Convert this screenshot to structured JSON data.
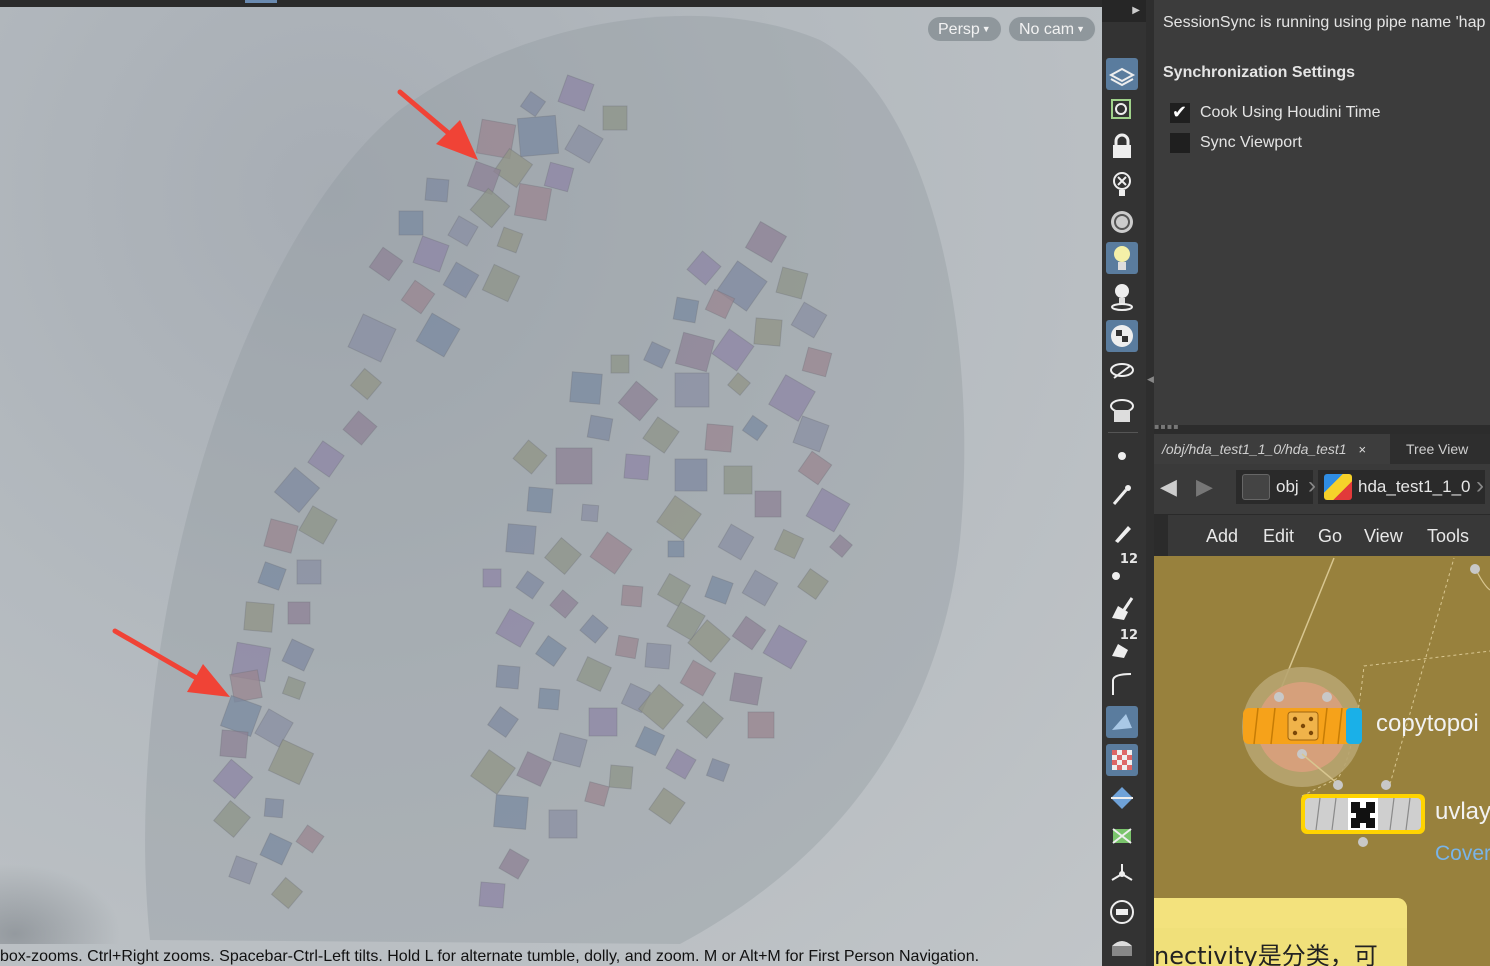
{
  "viewport": {
    "persp_label": "Persp",
    "cam_label": "No cam",
    "status_text": "box-zooms. Ctrl+Right zooms. Spacebar-Ctrl-Left tilts. Hold L for alternate tumble, dolly, and zoom. M or Alt+M for First Person Navigation."
  },
  "shelf": {
    "icons": [
      "selection-mode-icon",
      "view-mode-icon",
      "lock-camera-icon",
      "hide-light-icon",
      "headlight-icon",
      "light-on-icon",
      "light-pin-icon",
      "display-options-icon",
      "ghost-icon",
      "camera-view-icon",
      "dot-icon",
      "brush-icon",
      "pen-icon",
      "point-number-icon",
      "shovel-icon",
      "prim-number-icon",
      "curve-icon",
      "render-region-icon",
      "checker-icon",
      "diamond-icon",
      "uv-icon",
      "snap-icon",
      "toggle-icon",
      "display-icon"
    ],
    "badge_12": "12"
  },
  "sessionsync": {
    "message": "SessionSync is running using pipe name 'hap",
    "heading": "Synchronization Settings",
    "options": [
      {
        "label": "Cook Using Houdini Time",
        "checked": true
      },
      {
        "label": "Sync Viewport",
        "checked": false
      }
    ]
  },
  "network": {
    "tab_path": "/obj/hda_test1_1_0/hda_test1",
    "tab_close": "×",
    "tab_tree": "Tree View",
    "crumbs": [
      "obj",
      "hda_test1_1_0"
    ],
    "menu": [
      "Add",
      "Edit",
      "Go",
      "View",
      "Tools"
    ],
    "nodes": [
      {
        "name": "copytopoi"
      },
      {
        "name": "uvlay",
        "comment": "Cover"
      }
    ],
    "sticky_note": "nectivity是分类，可"
  },
  "colors": {
    "arrow": "#f04336",
    "network_bg": "#98813d",
    "accent_blue": "#5a7c9e",
    "node_orange": "#f6a21a",
    "node_cyan": "#1ab0e8",
    "sticky_yellow": "#f0e07a"
  }
}
